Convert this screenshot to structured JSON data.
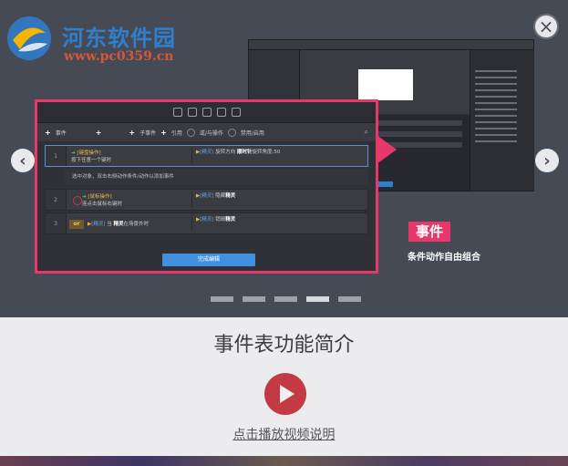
{
  "watermark": {
    "name": "河东软件园",
    "url": "www.pc0359.cn"
  },
  "close_icon": "close-icon",
  "carousel": {
    "prev_icon": "chevron-left-icon",
    "next_icon": "chevron-right-icon",
    "pages": 5,
    "active_page": 4,
    "slide": {
      "tag": "事件",
      "caption": "条件动作自由组合",
      "accent_color": "#e6386a",
      "event_panel": {
        "toolbar_actions": [
          {
            "icon": "plus-icon",
            "label": "事件"
          },
          {
            "icon": "plus-icon",
            "label": ""
          },
          {
            "icon": "plus-icon",
            "label": "子事件"
          },
          {
            "icon": "plus-icon",
            "label": "引用"
          },
          {
            "icon": "check-icon",
            "label": "或/与操作"
          },
          {
            "icon": "check-icon",
            "label": "禁用/启用"
          }
        ],
        "rows": [
          {
            "index": "1",
            "cond_tag": "[键盘操作]",
            "cond_text": "按下任意一个键时",
            "action_tag": "[精灵]",
            "action_text": "旋转方向 ",
            "action_bold": "顺时针",
            "action_tail": "旋转角度:50"
          },
          {
            "note": "选中对象，双击右侧动作条件/动作以添加事件"
          },
          {
            "index": "2",
            "cond_tag": "[鼠标操作]",
            "cond_text": "连点击鼠标右键时",
            "action_tag": "[精灵]",
            "action_text": "隐藏",
            "action_bold": "精灵",
            "action_tail": ""
          },
          {
            "index": "3",
            "or_label": "or",
            "cond_tag": "[精灵]",
            "cond_text": "当 ",
            "cond_bold": "精灵",
            "cond_tail": "在场景外时",
            "action_tag": "[精灵]",
            "action_text": "销毁",
            "action_bold": "精灵",
            "action_tail": ""
          }
        ],
        "done_label": "完成编辑"
      }
    }
  },
  "section_title": "事件表功能简介",
  "play_icon": "play-icon",
  "video_link": "点击播放视频说明"
}
